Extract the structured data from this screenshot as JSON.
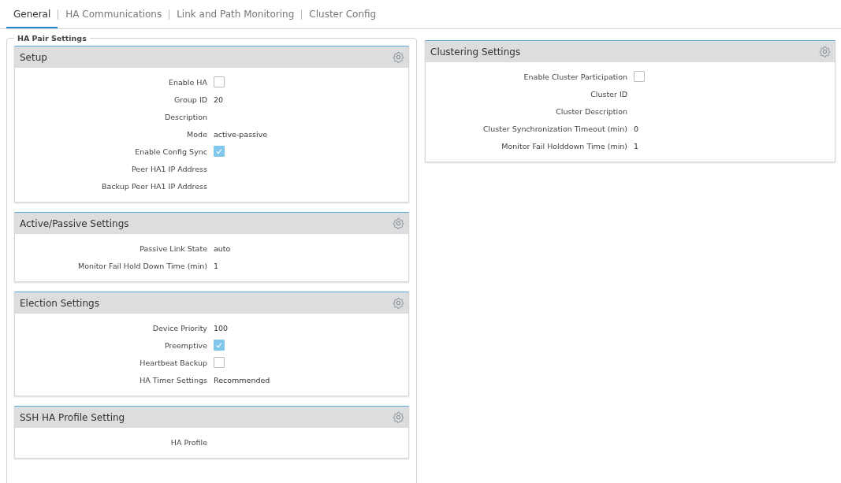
{
  "tabs": [
    {
      "label": "General",
      "selected": true
    },
    {
      "label": "HA Communications",
      "selected": false
    },
    {
      "label": "Link and Path Monitoring",
      "selected": false
    },
    {
      "label": "Cluster Config",
      "selected": false
    }
  ],
  "ha_pair_settings": {
    "title": "HA Pair Settings",
    "panels": [
      {
        "title": "Setup",
        "fields": [
          {
            "label": "Enable HA",
            "kind": "checkbox",
            "checked": false
          },
          {
            "label": "Group ID",
            "kind": "text",
            "value": "20"
          },
          {
            "label": "Description",
            "kind": "text"
          },
          {
            "label": "Mode",
            "kind": "text",
            "value": "active-passive"
          },
          {
            "label": "Enable Config Sync",
            "kind": "checkbox",
            "checked": true
          },
          {
            "label": "Peer HA1 IP Address",
            "kind": "text"
          },
          {
            "label": "Backup Peer HA1 IP Address",
            "kind": "text"
          }
        ]
      },
      {
        "title": "Active/Passive Settings",
        "fields": [
          {
            "label": "Passive Link State",
            "kind": "text",
            "value": "auto"
          },
          {
            "label": "Monitor Fail Hold Down Time (min)",
            "kind": "text",
            "value": "1"
          }
        ]
      },
      {
        "title": "Election Settings",
        "fields": [
          {
            "label": "Device Priority",
            "kind": "text",
            "value": "100"
          },
          {
            "label": "Preemptive",
            "kind": "checkbox",
            "checked": true
          },
          {
            "label": "Heartbeat Backup",
            "kind": "checkbox",
            "checked": false
          },
          {
            "label": "HA Timer Settings",
            "kind": "text",
            "value": "Recommended"
          }
        ]
      },
      {
        "title": "SSH HA Profile Setting",
        "fields": [
          {
            "label": "HA Profile",
            "kind": "text"
          }
        ]
      }
    ]
  },
  "clustering_settings": {
    "title": "Clustering Settings",
    "fields": [
      {
        "label": "Enable Cluster Participation",
        "kind": "checkbox",
        "checked": false
      },
      {
        "label": "Cluster ID",
        "kind": "text"
      },
      {
        "label": "Cluster Description",
        "kind": "text"
      },
      {
        "label": "Cluster Synchronization Timeout (min)",
        "kind": "text",
        "value": "0"
      },
      {
        "label": "Monitor Fail Holddown Time (min)",
        "kind": "text",
        "value": "1"
      }
    ]
  }
}
